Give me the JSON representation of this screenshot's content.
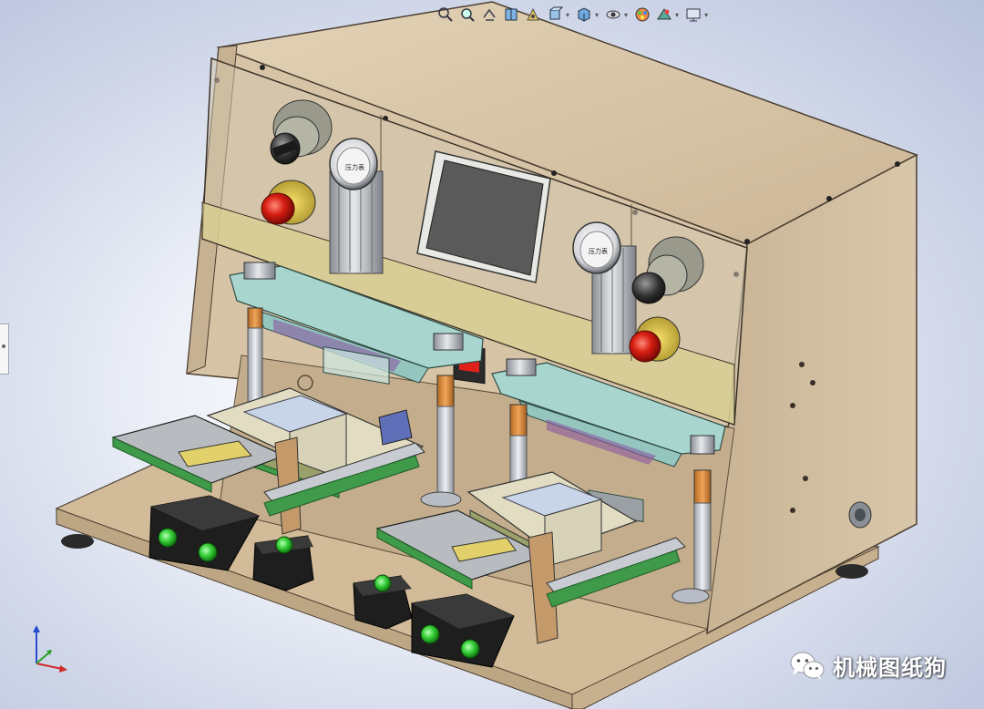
{
  "watermark": {
    "text": "机械图纸狗",
    "logo": "wechat-icon"
  },
  "heads_up_toolbar": {
    "tools": [
      {
        "name": "zoom-to-fit-icon"
      },
      {
        "name": "zoom-to-area-icon"
      },
      {
        "name": "previous-view-icon"
      },
      {
        "name": "section-view-icon"
      },
      {
        "name": "dynamic-annotation-icon"
      },
      {
        "name": "view-orientation-icon"
      },
      {
        "name": "display-style-icon"
      },
      {
        "name": "hide-show-items-icon"
      },
      {
        "name": "edit-appearance-icon"
      },
      {
        "name": "apply-scene-icon"
      },
      {
        "name": "view-settings-icon"
      }
    ]
  },
  "model": {
    "gauge_left_label": "压力表",
    "gauge_right_label": "压力表",
    "colors": {
      "cabinet": "#d9c6a9",
      "cabinet_side": "#cdb899",
      "acrylic_panel": "#d8cfa3",
      "upper_plates": "#a8d6cf",
      "pcb_green": "#3f9a4a",
      "copper_pins": "#d98a3a",
      "button_green": "#3bd13b",
      "switch_red": "#e0201a",
      "screen": "#5a5a5a",
      "background_center": "#ffffff",
      "background_edge": "#b8c2dc"
    }
  }
}
